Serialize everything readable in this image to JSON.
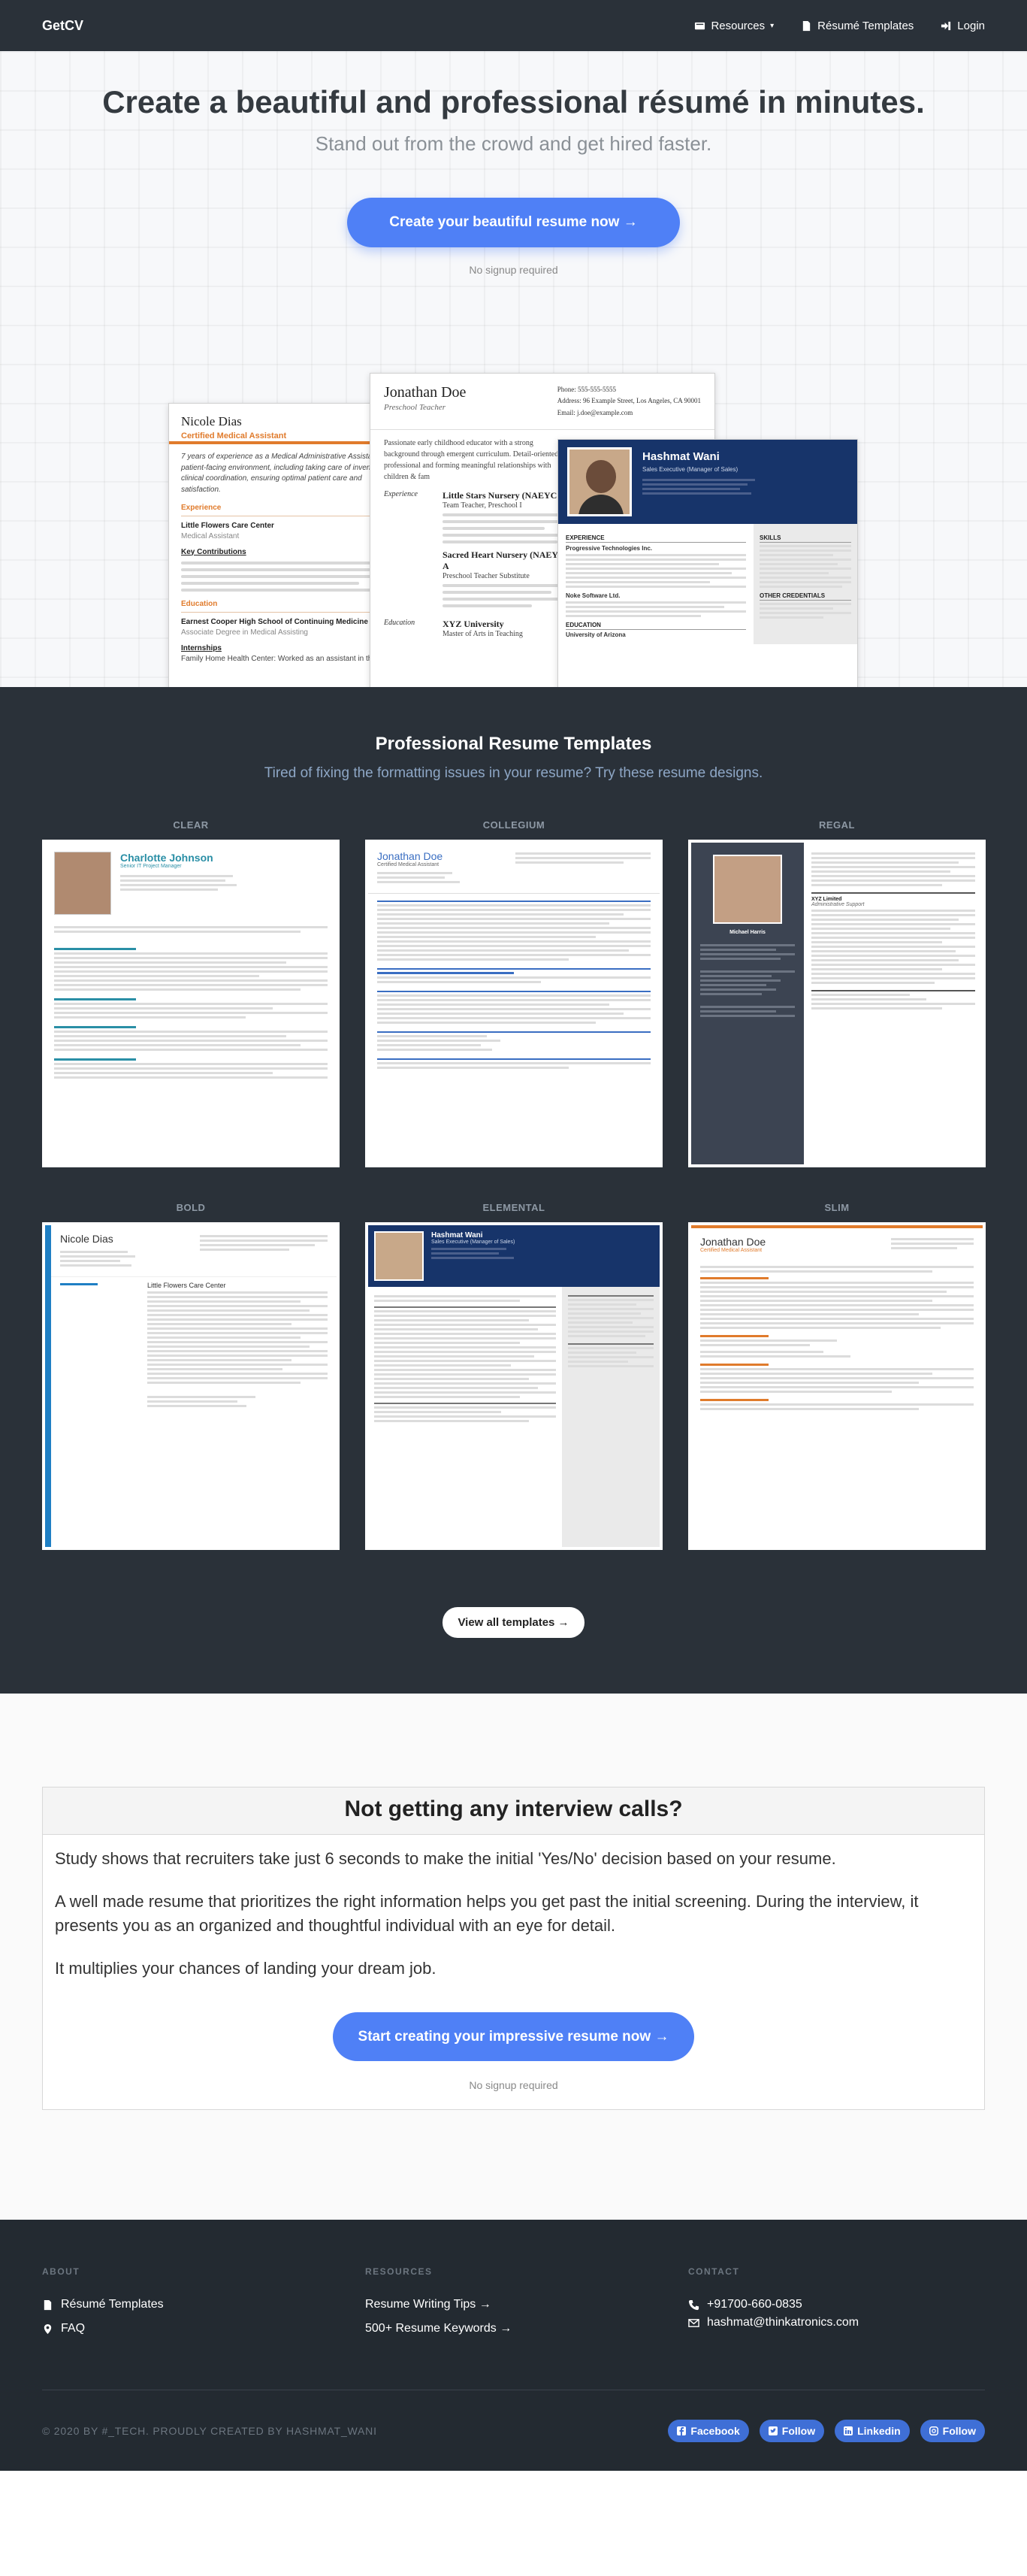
{
  "nav": {
    "brand": "GetCV",
    "resources": "Resources",
    "templates": "Résumé Templates",
    "login": "Login"
  },
  "hero": {
    "title": "Create a beautiful and professional résumé in minutes.",
    "subtitle": "Stand out from the crowd and get hired faster.",
    "cta": "Create your beautiful resume now →",
    "note": "No signup required"
  },
  "previews": {
    "left": {
      "name": "Nicole Dias",
      "role": "Certified Medical Assistant",
      "summary": "7 years of experience as a Medical Administrative Assistant in a patient-facing environment, including taking care of inventory and clinical coordination, ensuring optimal patient care and satisfaction.",
      "experience": "Experience",
      "company": "Little Flowers Care Center",
      "position": "Medical Assistant",
      "key": "Key Contributions",
      "education": "Education",
      "school": "Earnest Cooper High School of Continuing Medicine",
      "degree": "Associate Degree in Medical Assisting",
      "internships": "Internships",
      "intern": "Family Home Health Center: Worked as an assistant in the Care"
    },
    "middle": {
      "name": "Jonathan Doe",
      "role": "Preschool Teacher",
      "phone": "Phone: 555-555-5555",
      "address": "Address: 96 Example Street, Los Angeles, CA 90001",
      "email": "Email: j.doe@example.com",
      "summary": "Passionate early childhood educator with a strong background through emergent curriculum. Detail-oriented professional and forming meaningful relationships with children & fam",
      "experience_label": "Experience",
      "job1": "Little Stars Nursery (NAEYC A",
      "job1_role": "Team Teacher, Preschool I",
      "job2": "Sacred Heart Nursery (NAEYC A",
      "job2_role": "Preschool Teacher Substitute",
      "education_label": "Education",
      "school": "XYZ University",
      "degree": "Master of Arts in Teaching"
    },
    "right": {
      "name": "Hashmat Wani",
      "subtitle": "Sales Executive (Manager of Sales)",
      "experience": "EXPERIENCE",
      "company": "Progressive Technologies Inc.",
      "company2": "Noke Software Ltd.",
      "education": "EDUCATION",
      "school": "University of Arizona",
      "skills": "SKILLS",
      "other": "OTHER CREDENTIALS"
    }
  },
  "templates": {
    "title": "Professional Resume Templates",
    "subtitle": "Tired of fixing the formatting issues in your resume? Try these resume designs.",
    "items": [
      {
        "label": "CLEAR",
        "name": "Charlotte Johnson",
        "role": "Senior IT Project Manager"
      },
      {
        "label": "COLLEGIUM",
        "name": "Jonathan Doe",
        "role": "Certified Medical Assistant"
      },
      {
        "label": "REGAL",
        "name": "Michael Harris",
        "role": "Administrative Support"
      },
      {
        "label": "BOLD",
        "name": "Nicole Dias",
        "role": "Little Flowers Care Center"
      },
      {
        "label": "ELEMENTAL",
        "name": "Hashmat Wani",
        "role": "Sales Executive (Manager of Sales)"
      },
      {
        "label": "SLIM",
        "name": "Jonathan Doe",
        "role": "Certified Medical Assistant"
      }
    ],
    "view_all": "View all templates →"
  },
  "callout": {
    "title": "Not getting any interview calls?",
    "p1": "Study shows that recruiters take just 6 seconds to make the initial 'Yes/No' decision based on your resume.",
    "p2": "A well made resume that prioritizes the right information helps you get past the initial screening. During the interview, it presents you as an organized and thoughtful individual with an eye for detail.",
    "p3": "It multiplies your chances of landing your dream job.",
    "cta": "Start creating your impressive resume now →",
    "note": "No signup required"
  },
  "footer": {
    "about": "ABOUT",
    "resume_templates": "Résumé Templates",
    "faq": "FAQ",
    "resources": "RESOURCES",
    "writing_tips": "Resume Writing Tips →",
    "keywords": "500+ Resume Keywords →",
    "contact": "CONTACT",
    "phone": "+91700-660-0835",
    "email": "hashmat@thinkatronics.com",
    "copyright": "© 2020 BY #_TECH. PROUDLY CREATED BY HASHMAT_WANI",
    "facebook": "Facebook",
    "twitter": "Follow",
    "linkedin": "Linkedin",
    "instagram": "Follow"
  },
  "colors": {
    "primary": "#4f80f6",
    "dark": "#2a3139",
    "footer": "#232a31",
    "accent_orange": "#e07b2c",
    "navy": "#17346a"
  }
}
